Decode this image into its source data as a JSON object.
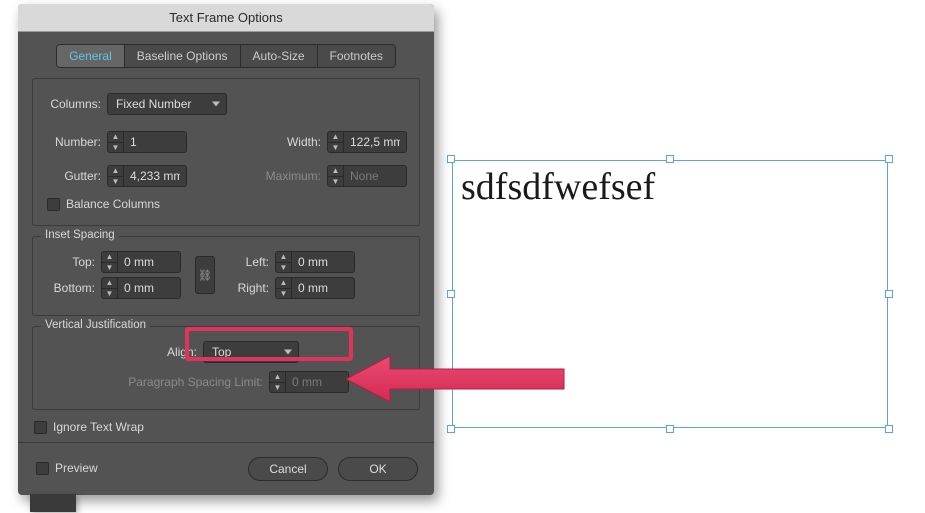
{
  "dialog": {
    "title": "Text Frame Options",
    "tabs": [
      "General",
      "Baseline Options",
      "Auto-Size",
      "Footnotes"
    ],
    "active_tab": 0,
    "columns": {
      "label": "Columns:",
      "mode": "Fixed Number",
      "number_label": "Number:",
      "number": "1",
      "gutter_label": "Gutter:",
      "gutter": "4,233 mm",
      "width_label": "Width:",
      "width": "122,5 mm",
      "maximum_label": "Maximum:",
      "maximum": "None",
      "balance_label": "Balance Columns"
    },
    "inset": {
      "group_label": "Inset Spacing",
      "top_label": "Top:",
      "top": "0 mm",
      "bottom_label": "Bottom:",
      "bottom": "0 mm",
      "left_label": "Left:",
      "left": "0 mm",
      "right_label": "Right:",
      "right": "0 mm"
    },
    "vjust": {
      "group_label": "Vertical Justification",
      "align_label": "Align:",
      "align": "Top",
      "para_label": "Paragraph Spacing Limit:",
      "para": "0 mm"
    },
    "ignore_wrap": "Ignore Text Wrap",
    "preview": "Preview",
    "buttons": {
      "cancel": "Cancel",
      "ok": "OK"
    }
  },
  "frame": {
    "text": "sdfsdfwefsef"
  },
  "colors": {
    "highlight": "#e1335e",
    "selection": "#5aa4e0"
  }
}
